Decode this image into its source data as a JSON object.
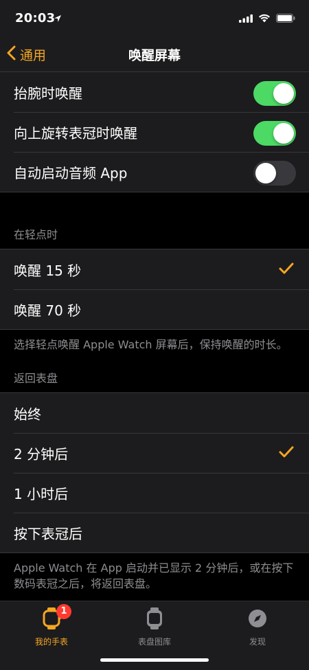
{
  "status_bar": {
    "time": "20:03"
  },
  "nav": {
    "back_label": "通用",
    "title": "唤醒屏幕"
  },
  "toggles": [
    {
      "label": "抬腕时唤醒",
      "on": true
    },
    {
      "label": "向上旋转表冠时唤醒",
      "on": true
    },
    {
      "label": "自动启动音频 App",
      "on": false
    }
  ],
  "tap_section": {
    "header": "在轻点时",
    "options": [
      {
        "label": "唤醒 15 秒",
        "selected": true
      },
      {
        "label": "唤醒 70 秒",
        "selected": false
      }
    ],
    "footer": "选择轻点唤醒 Apple Watch 屏幕后，保持唤醒的时长。"
  },
  "return_section": {
    "header": "返回表盘",
    "options": [
      {
        "label": "始终",
        "selected": false
      },
      {
        "label": "2 分钟后",
        "selected": true
      },
      {
        "label": "1 小时后",
        "selected": false
      },
      {
        "label": "按下表冠后",
        "selected": false
      }
    ],
    "footer": "Apple Watch 在 App 启动并已显示 2 分钟后，或在按下数码表冠之后，将返回表盘。"
  },
  "tabs": [
    {
      "label": "我的手表",
      "icon": "watch-icon",
      "active": true,
      "badge": "1"
    },
    {
      "label": "表盘图库",
      "icon": "watch-face-gallery-icon",
      "active": false
    },
    {
      "label": "发现",
      "icon": "compass-icon",
      "active": false
    }
  ],
  "colors": {
    "accent": "#f5a623",
    "toggle_on": "#4cd964",
    "badge": "#ff3b30"
  }
}
